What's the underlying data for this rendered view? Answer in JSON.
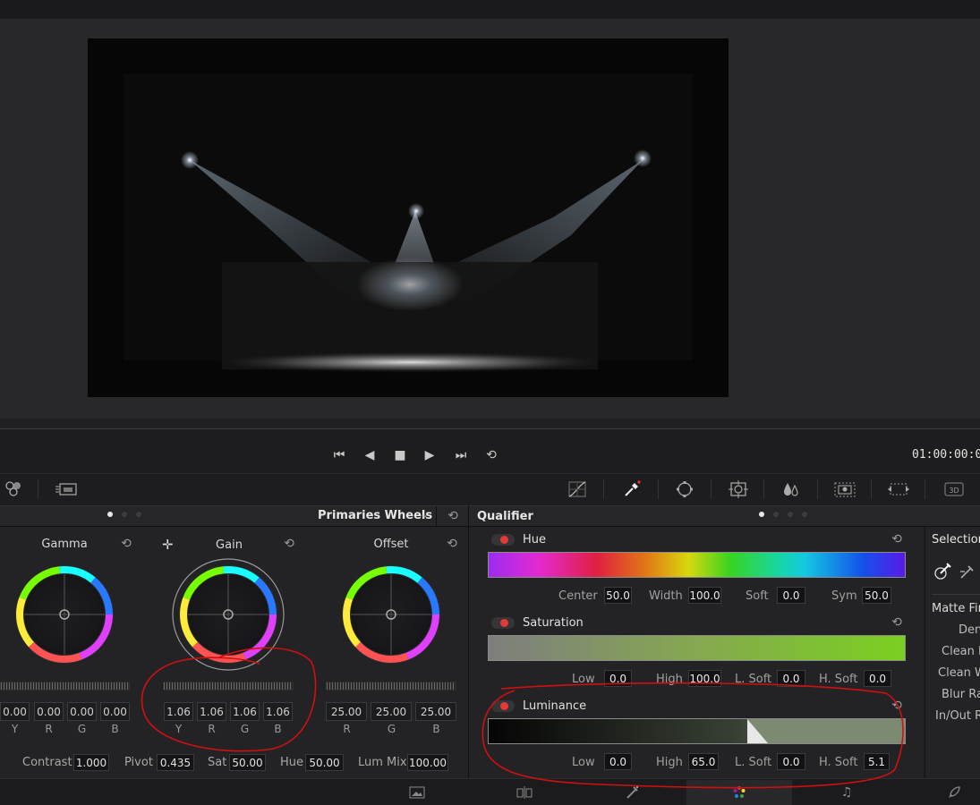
{
  "transport": {
    "skip_start": "⏮",
    "prev": "◀",
    "stop": "■",
    "play": "▶",
    "skip_end": "⏭",
    "loop": "⟲",
    "timecode": "01:00:00:0"
  },
  "primaries": {
    "title": "Primaries Wheels",
    "wheels": [
      {
        "name": "Gamma",
        "values": [
          "0.00",
          "0.00",
          "0.00",
          "0.00"
        ],
        "labels": [
          "Y",
          "R",
          "G",
          "B"
        ]
      },
      {
        "name": "Gain",
        "values": [
          "1.06",
          "1.06",
          "1.06",
          "1.06"
        ],
        "labels": [
          "Y",
          "R",
          "G",
          "B"
        ]
      },
      {
        "name": "Offset",
        "values": [
          "25.00",
          "25.00",
          "25.00"
        ],
        "labels": [
          "R",
          "G",
          "B"
        ]
      }
    ],
    "bottom": {
      "contrast_label": "Contrast",
      "contrast": "1.000",
      "pivot_label": "Pivot",
      "pivot": "0.435",
      "sat_label": "Sat",
      "sat": "50.00",
      "hue_label": "Hue",
      "hue": "50.00",
      "lummix_label": "Lum Mix",
      "lummix": "100.00"
    }
  },
  "qualifier": {
    "title": "Qualifier",
    "hue": {
      "label": "Hue",
      "center_label": "Center",
      "center": "50.0",
      "width_label": "Width",
      "width": "100.0",
      "soft_label": "Soft",
      "soft": "0.0",
      "sym_label": "Sym",
      "sym": "50.0"
    },
    "saturation": {
      "label": "Saturation",
      "low_label": "Low",
      "low": "0.0",
      "high_label": "High",
      "high": "100.0",
      "lsoft_label": "L. Soft",
      "lsoft": "0.0",
      "hsoft_label": "H. Soft",
      "hsoft": "0.0"
    },
    "luminance": {
      "label": "Luminance",
      "low_label": "Low",
      "low": "0.0",
      "high_label": "High",
      "high": "65.0",
      "lsoft_label": "L. Soft",
      "lsoft": "0.0",
      "hsoft_label": "H. Soft",
      "hsoft": "5.1"
    }
  },
  "selection": {
    "title": "Selection",
    "matte_title": "Matte Fin",
    "items": [
      "Den",
      "Clean B",
      "Clean W",
      "Blur Ra",
      "In/Out R"
    ]
  },
  "colors": {
    "accent_red": "#e53935",
    "panel": "#232325"
  }
}
